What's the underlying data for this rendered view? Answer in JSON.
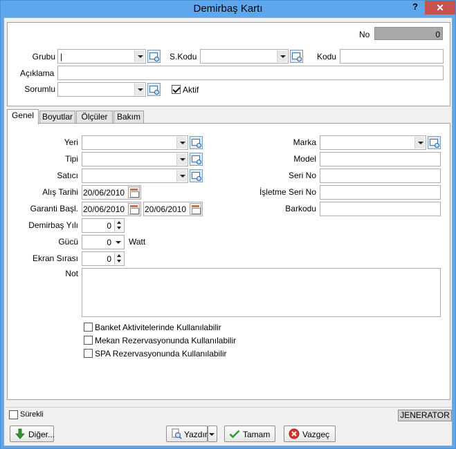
{
  "window": {
    "title": "Demirbaş Kartı",
    "help_label": "?",
    "close_label": "✕"
  },
  "header": {
    "no_label": "No",
    "no_value": "0",
    "grubu_label": "Grubu",
    "grubu_value": "|",
    "skodu_label": "S.Kodu",
    "skodu_value": "",
    "kodu_label": "Kodu",
    "kodu_value": "",
    "aciklama_label": "Açıklama",
    "aciklama_value": "",
    "sorumlu_label": "Sorumlu",
    "sorumlu_value": "",
    "aktif_label": "Aktif",
    "aktif_checked": true
  },
  "tabs": [
    {
      "label": "Genel",
      "active": true
    },
    {
      "label": "Boyutlar",
      "active": false
    },
    {
      "label": "Ölçüler",
      "active": false
    },
    {
      "label": "Bakım",
      "active": false
    }
  ],
  "genel": {
    "yeri_label": "Yeri",
    "yeri_value": "",
    "tipi_label": "Tipi",
    "tipi_value": "",
    "satici_label": "Satıcı",
    "satici_value": "",
    "alis_tarihi_label": "Alış Tarihi",
    "alis_tarihi_value": "20/06/2010",
    "garanti_label": "Garanti Başl.",
    "garanti_start": "20/06/2010",
    "garanti_end": "20/06/2010",
    "demirbas_yili_label": "Demirbaş Yılı",
    "demirbas_yili_value": "0",
    "gucu_label": "Gücü",
    "gucu_value": "0",
    "gucu_unit": "Watt",
    "ekran_sirasi_label": "Ekran Sırası",
    "ekran_sirasi_value": "0",
    "not_label": "Not",
    "not_value": "",
    "marka_label": "Marka",
    "marka_value": "",
    "model_label": "Model",
    "model_value": "",
    "seri_no_label": "Seri No",
    "seri_no_value": "",
    "isletme_seri_no_label": "İşletme Seri No",
    "isletme_seri_no_value": "",
    "barkodu_label": "Barkodu",
    "barkodu_value": "",
    "checkboxes": [
      {
        "label": "Banket Aktivitelerinde Kullanılabilir",
        "checked": false
      },
      {
        "label": "Mekan Rezervasyonunda Kullanılabilir",
        "checked": false
      },
      {
        "label": "SPA Rezervasyonunda Kullanılabilir",
        "checked": false
      }
    ]
  },
  "footer": {
    "surekli_label": "Sürekli",
    "surekli_checked": false,
    "jenerator_label": "JENERATOR",
    "diger_label": "Diğer...",
    "yazdir_label": "Yazdır",
    "tamam_label": "Tamam",
    "vazgec_label": "Vazgeç"
  },
  "colors": {
    "titlebar": "#5fa7ec",
    "close": "#c75050",
    "no_field": "#a9a9a9"
  }
}
